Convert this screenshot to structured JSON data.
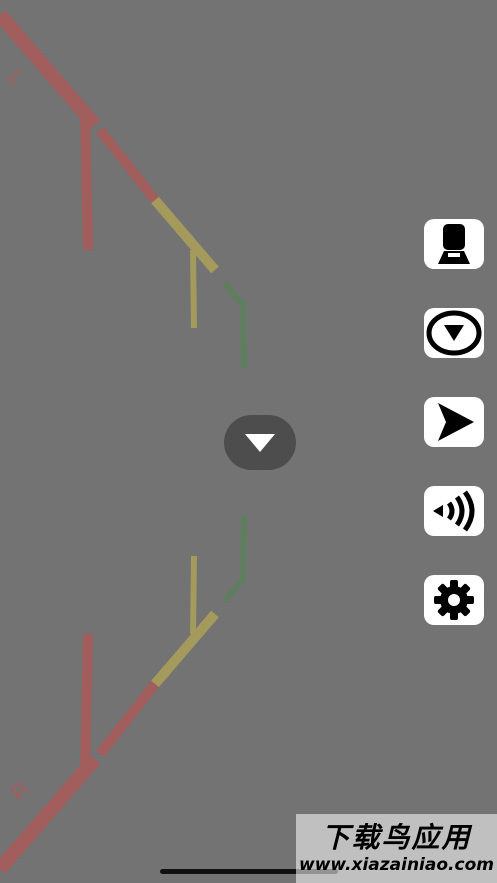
{
  "colors": {
    "background": "#737373",
    "red_line": "#a25d5d",
    "yellow_line": "#a39a5b",
    "green_line": "#5f7e5f",
    "button_bg": "#ffffff",
    "center_button_bg": "#4d4d4d"
  },
  "labels": {
    "left_side": "L",
    "right_side": "R"
  },
  "center_button": {
    "icon": "triangle-down-icon"
  },
  "side_buttons": [
    {
      "id": "bucket",
      "icon": "bucket-icon"
    },
    {
      "id": "down",
      "icon": "circle-down-arrow-icon"
    },
    {
      "id": "send",
      "icon": "send-icon"
    },
    {
      "id": "signal",
      "icon": "broadcast-icon"
    },
    {
      "id": "settings",
      "icon": "gear-icon"
    }
  ],
  "watermark": {
    "title": "下载鸟应用",
    "url": "www.xiazainiao.com"
  }
}
